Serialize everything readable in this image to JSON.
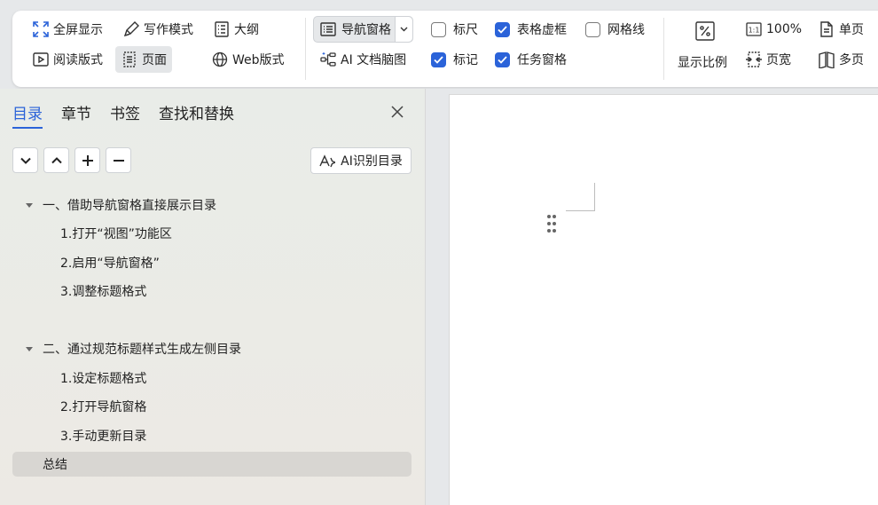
{
  "ribbon": {
    "fullscreen": "全屏显示",
    "writing_mode": "写作模式",
    "outline": "大纲",
    "reading_layout": "阅读版式",
    "page": "页面",
    "web_layout": "Web版式",
    "nav_pane": "导航窗格",
    "ai_mindmap": "AI 文档脑图",
    "checks": {
      "ruler": {
        "label": "标尺",
        "checked": false
      },
      "table_gridlines": {
        "label": "表格虚框",
        "checked": true
      },
      "gridlines": {
        "label": "网格线",
        "checked": false
      },
      "markup": {
        "label": "标记",
        "checked": true
      },
      "task_pane": {
        "label": "任务窗格",
        "checked": true
      }
    },
    "zoom_label": "显示比例",
    "zoom_100": "100%",
    "page_width": "页宽",
    "single_page": "单页",
    "multi_page": "多页"
  },
  "panel": {
    "tabs": [
      "目录",
      "章节",
      "书签",
      "查找和替换"
    ],
    "active_tab": 0,
    "ai_toc_button": "AI识别目录",
    "toc": [
      {
        "level": 1,
        "text": "一、借助导航窗格直接展示目录",
        "caret": true
      },
      {
        "level": 2,
        "text": "1.打开“视图”功能区"
      },
      {
        "level": 2,
        "text": "2.启用“导航窗格”"
      },
      {
        "level": 2,
        "text": "3.调整标题格式"
      },
      {
        "level": 1,
        "text": "二、通过规范标题样式生成左侧目录",
        "caret": true
      },
      {
        "level": 2,
        "text": "1.设定标题格式"
      },
      {
        "level": 2,
        "text": "2.打开导航窗格"
      },
      {
        "level": 2,
        "text": "3.手动更新目录"
      },
      {
        "level": 1,
        "text": "总结",
        "caret": false,
        "selected": true
      }
    ]
  },
  "colors": {
    "accent": "#2b63d9",
    "panel_bg": "#ebebe6",
    "selected_bg": "#d8d6d2"
  }
}
